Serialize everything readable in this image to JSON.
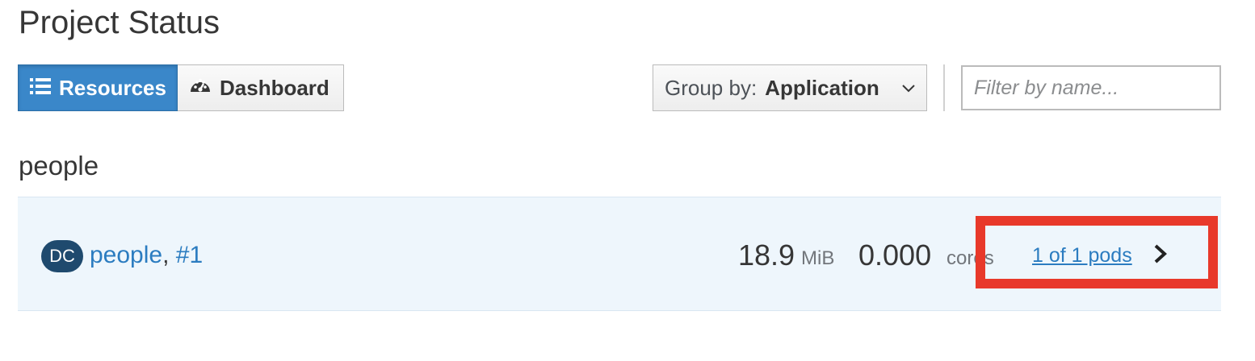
{
  "page": {
    "title": "Project Status"
  },
  "view_toggle": {
    "resources_label": "Resources",
    "dashboard_label": "Dashboard",
    "active": "Resources"
  },
  "toolbar": {
    "group_by_label": "Group by:",
    "group_by_value": "Application",
    "filter_placeholder": "Filter by name...",
    "filter_value": ""
  },
  "group": {
    "name": "people",
    "rows": [
      {
        "badge": "DC",
        "name": "people",
        "separator": ",",
        "deployment": "#1",
        "memory_value": "18.9",
        "memory_unit": "MiB",
        "cpu_value": "0.000",
        "cpu_unit": "cores",
        "pods_link": "1 of 1 pods"
      }
    ]
  },
  "colors": {
    "accent": "#3a87c9",
    "link": "#2b7cc0",
    "badge_bg": "#1f4a6e",
    "row_bg": "#eef6fc",
    "highlight": "#e8392a"
  },
  "icons": [
    "list-icon",
    "dashboard-icon",
    "chevron-down-icon",
    "chevron-right-icon"
  ]
}
